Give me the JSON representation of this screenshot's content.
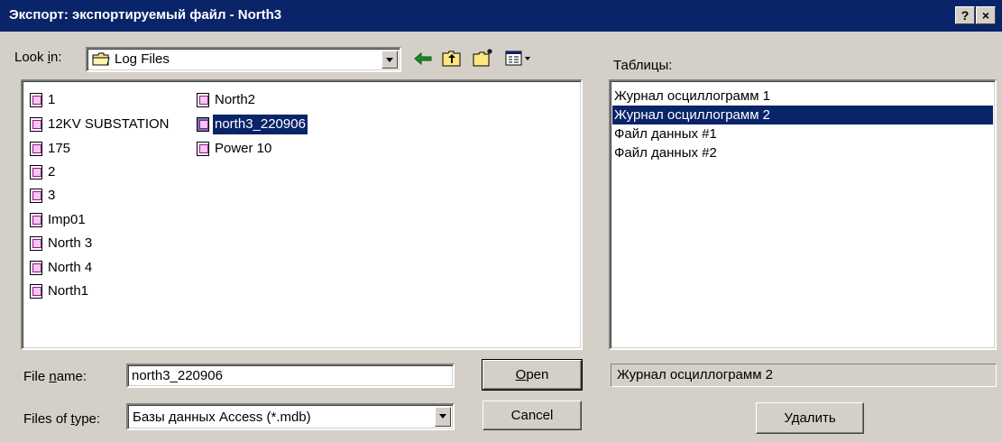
{
  "window": {
    "title": "Экспорт: экспортируемый файл - North3",
    "help_btn": "?",
    "close_btn": "×"
  },
  "look_in": {
    "label_pre": "Look ",
    "label_u": "i",
    "label_post": "n:",
    "value": "Log Files"
  },
  "tables_label": "Таблицы:",
  "files": [
    {
      "name": "1",
      "selected": false
    },
    {
      "name": "12KV SUBSTATION",
      "selected": false
    },
    {
      "name": "175",
      "selected": false
    },
    {
      "name": "2",
      "selected": false
    },
    {
      "name": "3",
      "selected": false
    },
    {
      "name": "Imp01",
      "selected": false
    },
    {
      "name": "North 3",
      "selected": false
    },
    {
      "name": "North 4",
      "selected": false
    },
    {
      "name": "North1",
      "selected": false
    },
    {
      "name": "North2",
      "selected": false
    },
    {
      "name": "north3_220906",
      "selected": true
    },
    {
      "name": "Power 10",
      "selected": false
    }
  ],
  "tables": [
    {
      "name": "Журнал осциллограмм 1",
      "selected": false
    },
    {
      "name": "Журнал осциллограмм 2",
      "selected": true
    },
    {
      "name": "Файл данных #1",
      "selected": false
    },
    {
      "name": "Файл данных #2",
      "selected": false
    }
  ],
  "file_name": {
    "label_pre": "File ",
    "label_u": "n",
    "label_post": "ame:",
    "value": "north3_220906"
  },
  "file_type": {
    "label_pre": "Files of ",
    "label_u": "t",
    "label_post": "ype:",
    "value": "Базы данных Access (*.mdb)"
  },
  "buttons": {
    "open_u": "O",
    "open_rest": "pen",
    "cancel": "Cancel",
    "delete": "Удалить"
  },
  "selected_table_display": "Журнал осциллограмм 2",
  "colors": {
    "titlebar": "#0a246a",
    "face": "#d4d0c8",
    "selection": "#0a246a"
  }
}
